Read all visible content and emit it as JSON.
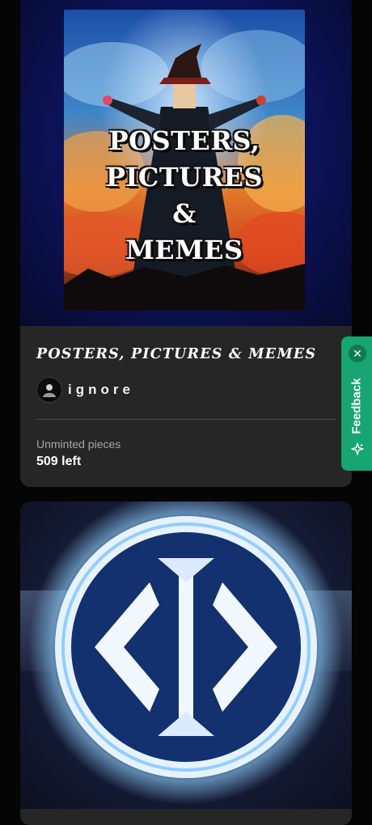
{
  "listings": [
    {
      "poster_lines": [
        "POSTERS,",
        "PICTURES",
        "&",
        "MEMES"
      ],
      "title": "POSTERS, PICTURES & MEMES",
      "creator": "ignore",
      "stat_label": "Unminted pieces",
      "stat_value": "509 left"
    }
  ],
  "feedback": {
    "label": "Feedback",
    "close_glyph": "✕",
    "icon": "sparkle-icon"
  },
  "colors": {
    "card_bg": "#262626",
    "page_bg": "#050505",
    "feedback_green": "#17a571",
    "muted_text": "#a6a6a6"
  }
}
